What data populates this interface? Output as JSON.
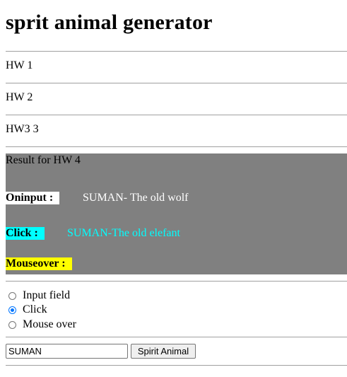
{
  "page": {
    "title": "sprit animal generator"
  },
  "homework": {
    "hw1": "HW 1",
    "hw2": "HW 2",
    "hw3": "HW3 3"
  },
  "result": {
    "title": "Result for HW 4",
    "oninput": {
      "label": "Oninput :",
      "value": "SUMAN- The old wolf"
    },
    "click": {
      "label": "Click :",
      "value": "SUMAN-The old elefant"
    },
    "mouseover": {
      "label": "Mouseover :",
      "value": ""
    }
  },
  "options": [
    {
      "label": "Input field",
      "checked": false
    },
    {
      "label": "Click",
      "checked": true
    },
    {
      "label": "Mouse over",
      "checked": false
    }
  ],
  "form": {
    "name_value": "SUMAN",
    "button_label": "Spirit Animal"
  },
  "colors": {
    "result_bg": "#808080",
    "oninput_label_bg": "#ffffff",
    "oninput_value": "#ffffff",
    "click_label_bg": "#00ffff",
    "click_value": "#00ffff",
    "mouseover_label_bg": "#ffff00",
    "radio_checked": "#0075ff"
  }
}
